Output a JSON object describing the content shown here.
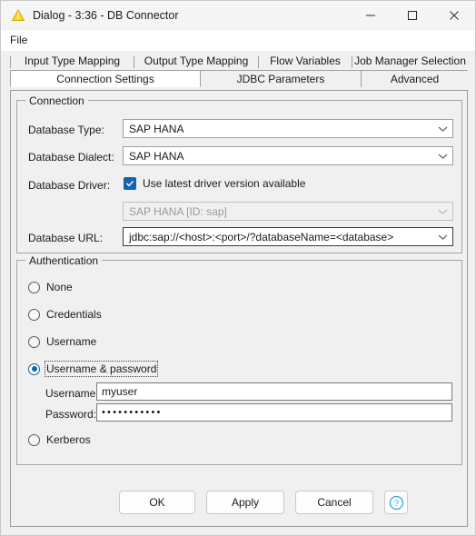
{
  "window": {
    "title": "Dialog - 3:36 - DB Connector",
    "icon": "knime-triangle-icon",
    "controls": {
      "minimize": "minimize-icon",
      "maximize": "maximize-icon",
      "close": "close-icon"
    }
  },
  "menubar": {
    "items": [
      {
        "label": "File"
      }
    ]
  },
  "tabs": {
    "top_row": [
      {
        "label": "Input Type Mapping",
        "active": false
      },
      {
        "label": "Output Type Mapping",
        "active": false
      },
      {
        "label": "Flow Variables",
        "active": false
      },
      {
        "label": "Job Manager Selection",
        "active": false
      }
    ],
    "bottom_row": [
      {
        "label": "Connection Settings",
        "active": true
      },
      {
        "label": "JDBC Parameters",
        "active": false
      },
      {
        "label": "Advanced",
        "active": false
      }
    ]
  },
  "connection": {
    "group_title": "Connection",
    "database_type": {
      "label": "Database Type:",
      "value": "SAP HANA"
    },
    "database_dialect": {
      "label": "Database Dialect:",
      "value": "SAP HANA"
    },
    "database_driver": {
      "label": "Database Driver:",
      "checkbox_label": "Use latest driver version available",
      "checkbox_checked": true,
      "driver_value": "SAP HANA [ID: sap]",
      "driver_enabled": false
    },
    "database_url": {
      "label": "Database URL:",
      "value": "jdbc:sap://<host>:<port>/?databaseName=<database>"
    }
  },
  "authentication": {
    "group_title": "Authentication",
    "options": [
      {
        "label": "None",
        "selected": false
      },
      {
        "label": "Credentials",
        "selected": false
      },
      {
        "label": "Username",
        "selected": false
      },
      {
        "label": "Username & password",
        "selected": true,
        "focused": true
      },
      {
        "label": "Kerberos",
        "selected": false
      }
    ],
    "username": {
      "label": "Username:",
      "value": "myuser"
    },
    "password": {
      "label": "Password:",
      "value": "•••••••••••"
    }
  },
  "buttons": {
    "ok": "OK",
    "apply": "Apply",
    "cancel": "Cancel",
    "help": "help-icon"
  },
  "colors": {
    "accent": "#1464ad",
    "help_blue": "#29abe2",
    "icon_yellow": "#ffd320",
    "dialog_bg": "#f0f0f0"
  }
}
